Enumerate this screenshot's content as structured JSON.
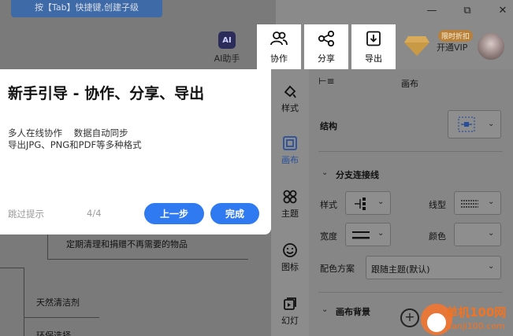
{
  "hint_banner": "按【Tab】快捷键,创建子级",
  "toolbar": {
    "ai": {
      "logo": "AI",
      "label": "AI助手"
    },
    "collaborate": "协作",
    "share": "分享",
    "export": "导出",
    "vip_badge": "限时折扣",
    "vip_label": "开通VIP"
  },
  "guide": {
    "title": "新手引导 - 协作、分享、导出",
    "desc_line1": "多人在线协作    数据自动同步",
    "desc_line2": "导出JPG、PNG和PDF等多种格式",
    "skip": "跳过提示",
    "page": "4/4",
    "prev": "上一步",
    "done": "完成"
  },
  "side_tabs": [
    "样式",
    "画布",
    "主题",
    "图标",
    "幻灯"
  ],
  "active_tab": "画布",
  "panel": {
    "title": "画布",
    "structure": "结构",
    "branch_section": "分支连接线",
    "style": "样式",
    "line_type": "线型",
    "width": "宽度",
    "color": "颜色",
    "scheme_label": "配色方案",
    "scheme_value": "跟随主题(默认)",
    "bg_section": "画布背景"
  },
  "mindmap": {
    "node1": "定期清理和捐赠不再需要的物品",
    "node2": "天然清洁剂",
    "node3": "环保选择"
  },
  "watermark": {
    "line1": "单机100网",
    "line2": "danji100.com"
  },
  "colors": {
    "primary": "#2f7af0",
    "active": "#2a4f9a"
  }
}
